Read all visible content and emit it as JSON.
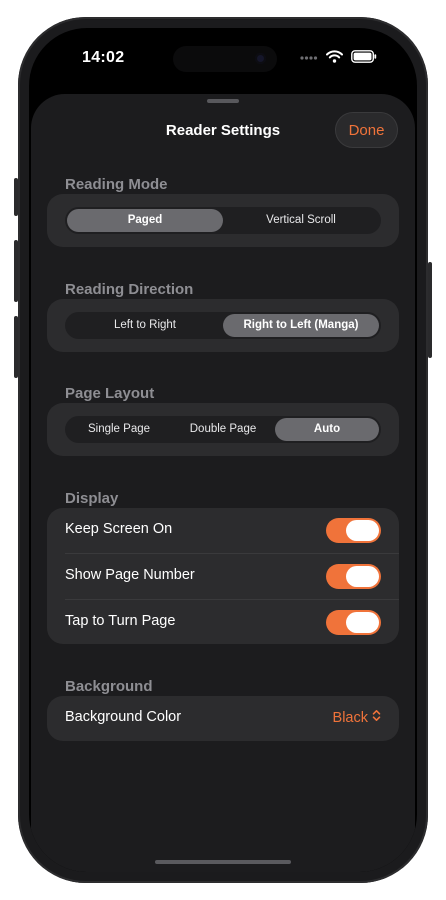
{
  "status_bar": {
    "time": "14:02",
    "icons": [
      "signal-icon",
      "wifi-icon",
      "battery-icon"
    ]
  },
  "sheet": {
    "title": "Reader Settings",
    "done_label": "Done"
  },
  "sections": {
    "reading_mode": {
      "label": "Reading Mode",
      "options": [
        "Paged",
        "Vertical Scroll"
      ],
      "selected": "Paged"
    },
    "reading_direction": {
      "label": "Reading Direction",
      "options": [
        "Left to Right",
        "Right to Left (Manga)"
      ],
      "selected": "Right to Left (Manga)"
    },
    "page_layout": {
      "label": "Page Layout",
      "options": [
        "Single Page",
        "Double Page",
        "Auto"
      ],
      "selected": "Auto"
    },
    "display": {
      "label": "Display",
      "toggles": [
        {
          "label": "Keep Screen On",
          "on": true
        },
        {
          "label": "Show Page Number",
          "on": true
        },
        {
          "label": "Tap to Turn Page",
          "on": true
        }
      ]
    },
    "background": {
      "label": "Background",
      "row_label": "Background Color",
      "value": "Black"
    }
  },
  "colors": {
    "accent": "#f0733a",
    "sheet_background": "#1c1c1e",
    "card_background": "#2c2c2e",
    "section_label": "#8e8e93"
  }
}
